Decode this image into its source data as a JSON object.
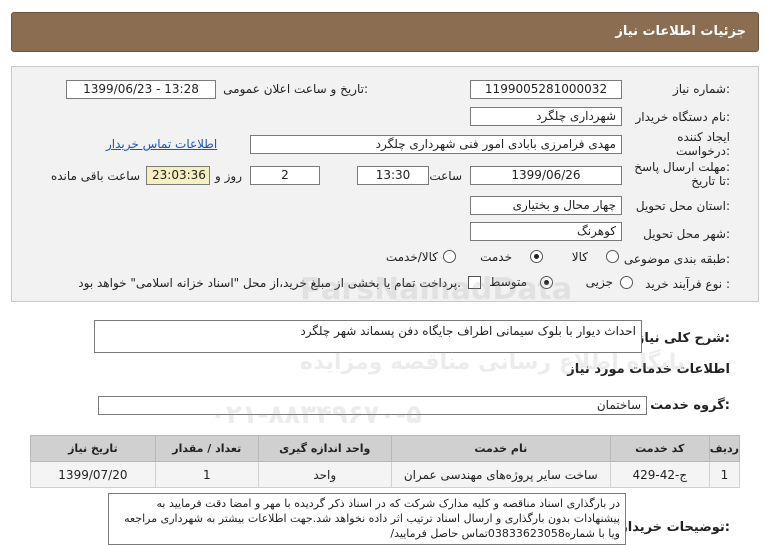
{
  "header": {
    "title": "جزئیات اطلاعات نیاز"
  },
  "need_number": {
    "label": "شماره نیاز:",
    "value": "1199005281000032"
  },
  "announce_date": {
    "label": "تاریخ و ساعت اعلان عمومی:",
    "value": "1399/06/23 - 13:28"
  },
  "buyer_org": {
    "label": "نام دستگاه خریدار:",
    "value": "شهرداری چلگرد"
  },
  "requester": {
    "label_line1": "ایجاد کننده",
    "label_line2": "درخواست:",
    "value": "مهدی فرامرزی بابادی امور فنی شهرداری چلگرد",
    "contact_link": "اطلاعات تماس خریدار"
  },
  "deadline": {
    "label_line1": "مهلت ارسال پاسخ:",
    "label_line2": "تا تاریخ:",
    "date": "1399/06/26",
    "time_label": "ساعت",
    "time": "13:30",
    "days": "2",
    "days_label": "روز و",
    "remaining": "23:03:36",
    "remaining_label": "ساعت باقی مانده"
  },
  "province": {
    "label": "استان محل تحویل:",
    "value": "چهار محال و بختیاری"
  },
  "city": {
    "label": "شهر محل تحویل:",
    "value": "کوهرنگ"
  },
  "category": {
    "label": "طبقه بندی موضوعی:",
    "options": [
      "کالا",
      "خدمت",
      "کالا/خدمت"
    ],
    "selected": "خدمت"
  },
  "purchase_process": {
    "label": "نوع فرآیند خرید :",
    "options": [
      "جزیی",
      "متوسط"
    ],
    "selected": "متوسط",
    "payment_note": "پرداخت تمام یا بخشی از مبلغ خرید،از محل \"اسناد خزانه اسلامی\" خواهد بود."
  },
  "summary": {
    "label": "شرح کلی نیاز:",
    "value": "احداث دیوار با بلوک سیمانی اطراف جایگاه دفن پسماند شهر چلگرد"
  },
  "services_section": {
    "title": "اطلاعات خدمات مورد نیاز"
  },
  "service_group": {
    "label": "گروه خدمت:",
    "value": "ساختمان"
  },
  "table": {
    "headers": [
      "ردیف",
      "کد خدمت",
      "نام خدمت",
      "واحد اندازه گیری",
      "تعداد / مقدار",
      "تاریخ نیاز"
    ],
    "rows": [
      [
        "1",
        "ج-42-429",
        "ساخت سایر پروژه‌های مهندسی عمران",
        "واحد",
        "1",
        "1399/07/20"
      ]
    ]
  },
  "buyer_notes": {
    "label": "توضیحات خریدار:",
    "value": "در بارگذاری اسناد مناقصه و کلیه مدارک شرکت که در اسناد ذکر گردیده با مهر و امضا دقت فرمایید به پیشنهادات بدون بارگذاری و ارسال اسناد ترتیب اثر داده نخواهد شد.جهت اطلاعات بیشتر به شهرداری مراجعه ویا با شماره03833623058تماس حاصل فرمایید/"
  },
  "watermark": {
    "line1": "ParsNamadData",
    "line2": "پایگاه اطلاع رسانی مناقصه ومزایده",
    "line3": "۰۲۱-۸۸۳۴۹۶۷۰-۵"
  },
  "colors": {
    "header_bg": "#8b6e51",
    "panel_bg": "#f2f2f2",
    "link": "#1a56b8",
    "remaining_bg": "#f6f0c0"
  }
}
